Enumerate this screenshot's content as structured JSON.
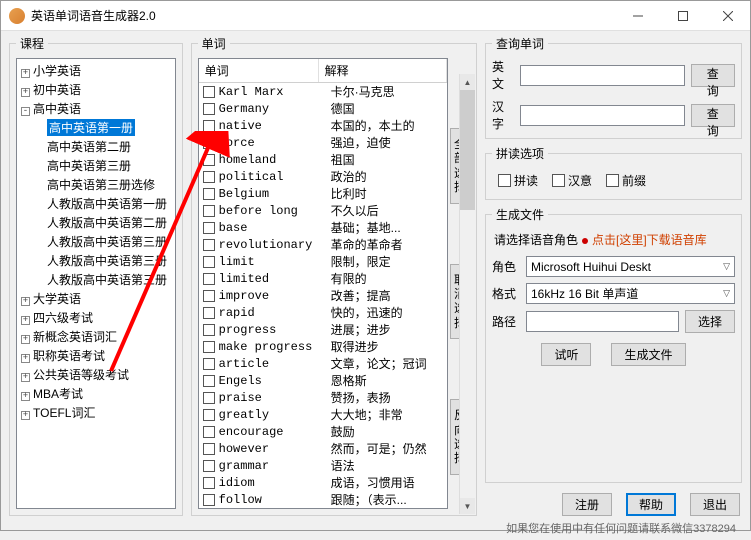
{
  "window": {
    "title": "英语单词语音生成器2.0"
  },
  "course": {
    "legend": "课程",
    "items": [
      {
        "label": "小学英语",
        "exp": "+",
        "indent": 0
      },
      {
        "label": "初中英语",
        "exp": "+",
        "indent": 0
      },
      {
        "label": "高中英语",
        "exp": "-",
        "indent": 0
      },
      {
        "label": "高中英语第一册",
        "exp": "",
        "indent": 1,
        "sel": true
      },
      {
        "label": "高中英语第二册",
        "exp": "",
        "indent": 1
      },
      {
        "label": "高中英语第三册",
        "exp": "",
        "indent": 1
      },
      {
        "label": "高中英语第三册选修",
        "exp": "",
        "indent": 1
      },
      {
        "label": "人教版高中英语第一册",
        "exp": "",
        "indent": 1
      },
      {
        "label": "人教版高中英语第二册",
        "exp": "",
        "indent": 1
      },
      {
        "label": "人教版高中英语第三册",
        "exp": "",
        "indent": 1
      },
      {
        "label": "人教版高中英语第三册",
        "exp": "",
        "indent": 1
      },
      {
        "label": "人教版高中英语第三册",
        "exp": "",
        "indent": 1
      },
      {
        "label": "大学英语",
        "exp": "+",
        "indent": 0
      },
      {
        "label": "四六级考试",
        "exp": "+",
        "indent": 0
      },
      {
        "label": "新概念英语词汇",
        "exp": "+",
        "indent": 0
      },
      {
        "label": "职称英语考试",
        "exp": "+",
        "indent": 0
      },
      {
        "label": "公共英语等级考试",
        "exp": "+",
        "indent": 0
      },
      {
        "label": "MBA考试",
        "exp": "+",
        "indent": 0
      },
      {
        "label": "TOEFL词汇",
        "exp": "+",
        "indent": 0
      }
    ]
  },
  "words": {
    "legend": "单词",
    "col1": "单词",
    "col2": "解释",
    "rows": [
      {
        "w": "Karl Marx",
        "t": "卡尔·马克思"
      },
      {
        "w": "Germany",
        "t": "德国"
      },
      {
        "w": "native",
        "t": "本国的，本土的"
      },
      {
        "w": "force",
        "t": "强迫，迫使"
      },
      {
        "w": "homeland",
        "t": "祖国"
      },
      {
        "w": "political",
        "t": "政治的"
      },
      {
        "w": "Belgium",
        "t": "比利时"
      },
      {
        "w": "before long",
        "t": "不久以后"
      },
      {
        "w": "base",
        "t": "基础；基地..."
      },
      {
        "w": "revolutionary",
        "t": "革命的革命者"
      },
      {
        "w": "limit",
        "t": "限制，限定"
      },
      {
        "w": "limited",
        "t": "有限的"
      },
      {
        "w": "improve",
        "t": "改善；提高"
      },
      {
        "w": "rapid",
        "t": "快的，迅速的"
      },
      {
        "w": "progress",
        "t": "进展；进步"
      },
      {
        "w": "make progress",
        "t": "取得进步"
      },
      {
        "w": "article",
        "t": "文章，论文；冠词"
      },
      {
        "w": "Engels",
        "t": "恩格斯"
      },
      {
        "w": "praise",
        "t": "赞扬，表扬"
      },
      {
        "w": "greatly",
        "t": "大大地；非常"
      },
      {
        "w": "encourage",
        "t": "鼓励"
      },
      {
        "w": "however",
        "t": "然而，可是；仍然"
      },
      {
        "w": "grammar",
        "t": "语法"
      },
      {
        "w": "idiom",
        "t": "成语，习惯用语"
      },
      {
        "w": "follow",
        "t": "跟随；（表示..."
      }
    ],
    "side_select_all": "全部选择",
    "side_cancel": "取消选择",
    "side_reverse": "反向选择"
  },
  "query": {
    "legend": "查询单词",
    "en_label": "英文",
    "cn_label": "汉字",
    "btn": "查询"
  },
  "spell": {
    "legend": "拼读选项",
    "opts": [
      "拼读",
      "汉意",
      "前缀"
    ]
  },
  "gen": {
    "legend": "生成文件",
    "tip_prefix": "请选择语音角色",
    "tip_link": "点击[这里]下载语音库",
    "role_label": "角色",
    "role_value": "Microsoft Huihui Deskt",
    "format_label": "格式",
    "format_value": "16kHz 16 Bit 单声道",
    "path_label": "路径",
    "path_btn": "选择",
    "preview_btn": "试听",
    "gen_btn": "生成文件"
  },
  "bottom": {
    "register": "注册",
    "help": "帮助",
    "exit": "退出"
  },
  "footer": "如果您在使用中有任何问题请联系微信3378294"
}
